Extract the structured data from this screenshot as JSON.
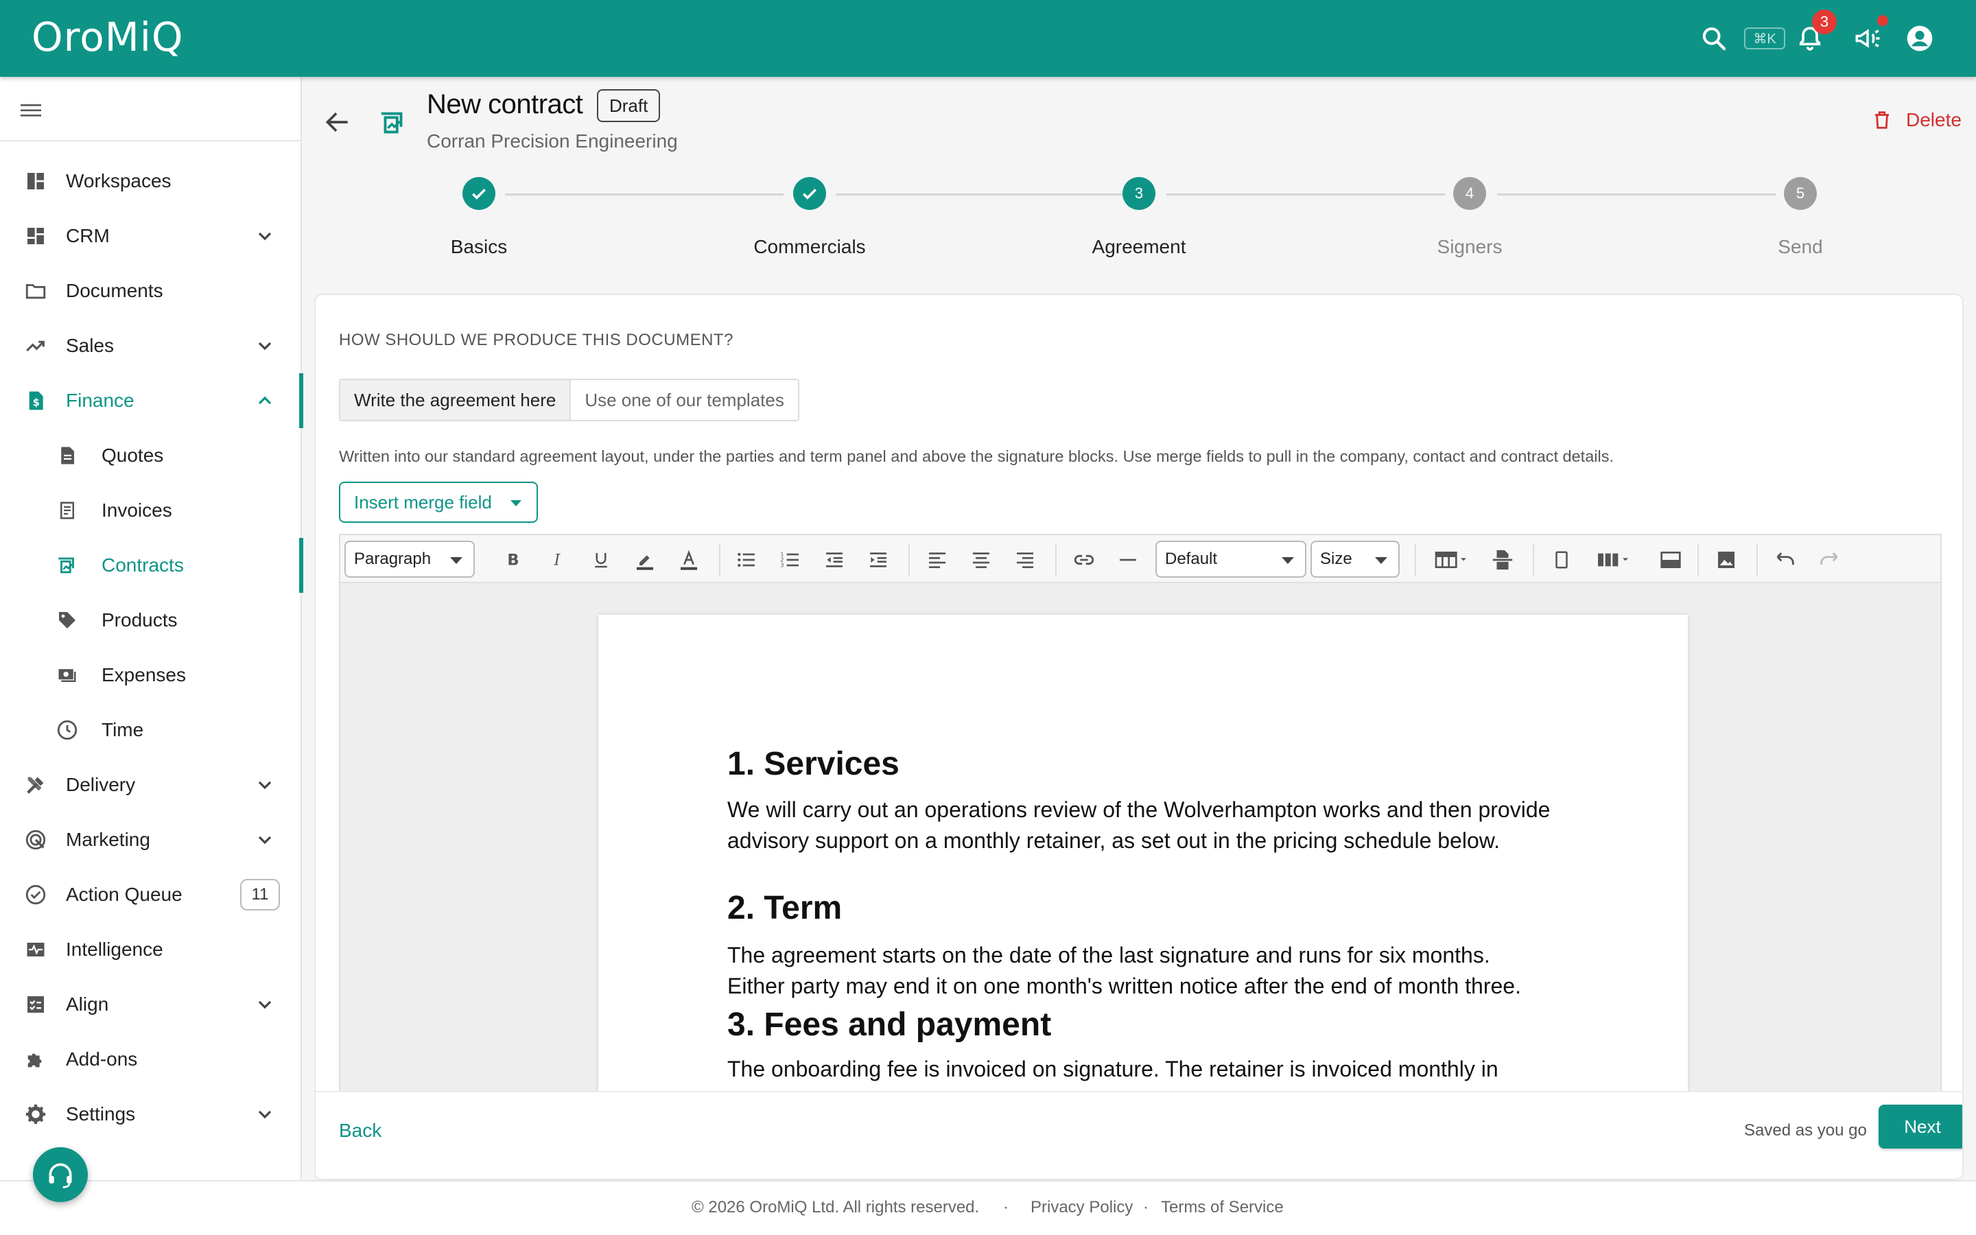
{
  "app": {
    "logo": "OroMiQ",
    "shortcut": "⌘K",
    "notification_count": "3"
  },
  "colors": {
    "accent": "#0e9486",
    "danger": "#d32f2f",
    "badge": "#e53935"
  },
  "sidebar": {
    "items": [
      {
        "label": "Workspaces",
        "icon": "dashboard-icon"
      },
      {
        "label": "CRM",
        "icon": "grid-icon"
      },
      {
        "label": "Documents",
        "icon": "folder-icon"
      },
      {
        "label": "Sales",
        "icon": "trending-up-icon"
      },
      {
        "label": "Finance",
        "icon": "finance-icon"
      },
      {
        "label": "Quotes",
        "icon": "document-icon"
      },
      {
        "label": "Invoices",
        "icon": "receipt-icon"
      },
      {
        "label": "Contracts",
        "icon": "contract-icon"
      },
      {
        "label": "Products",
        "icon": "tag-icon"
      },
      {
        "label": "Expenses",
        "icon": "money-icon"
      },
      {
        "label": "Time",
        "icon": "clock-icon"
      },
      {
        "label": "Delivery",
        "icon": "tools-icon"
      },
      {
        "label": "Marketing",
        "icon": "target-icon"
      },
      {
        "label": "Action Queue",
        "icon": "check-circle-icon",
        "count": "11"
      },
      {
        "label": "Intelligence",
        "icon": "pulse-icon"
      },
      {
        "label": "Align",
        "icon": "checklist-icon"
      },
      {
        "label": "Add-ons",
        "icon": "puzzle-icon"
      },
      {
        "label": "Settings",
        "icon": "gear-icon"
      }
    ]
  },
  "header": {
    "title": "New contract",
    "status": "Draft",
    "company": "Corran Precision Engineering",
    "delete_label": "Delete"
  },
  "stepper": {
    "steps": [
      {
        "number": "1",
        "label": "Basics",
        "state": "done"
      },
      {
        "number": "2",
        "label": "Commercials",
        "state": "done"
      },
      {
        "number": "3",
        "label": "Agreement",
        "state": "current"
      },
      {
        "number": "4",
        "label": "Signers",
        "state": "todo"
      },
      {
        "number": "5",
        "label": "Send",
        "state": "todo"
      }
    ]
  },
  "agreement": {
    "question": "HOW SHOULD WE PRODUCE THIS DOCUMENT?",
    "options": [
      "Write the agreement here",
      "Use one of our templates"
    ],
    "selected_option": "Write the agreement here",
    "help": "Written into our standard agreement layout, under the parties and term panel and above the signature blocks. Use merge fields to pull in the company, contact and contract details.",
    "merge_field_label": "Insert merge field"
  },
  "editor": {
    "block_format": "Paragraph",
    "font_family": "Default",
    "font_size": "Size",
    "sections": [
      {
        "heading": "1. Services",
        "body": "We will carry out an operations review of the Wolverhampton works and then provide advisory support on a monthly retainer, as set out in the pricing schedule below."
      },
      {
        "heading": "2. Term",
        "body": "The agreement starts on the date of the last signature and runs for six months. Either party may end it on one month's written notice after the end of month three."
      },
      {
        "heading": "3. Fees and payment",
        "body": "The onboarding fee is invoiced on signature. The retainer is invoiced monthly in"
      }
    ]
  },
  "footer_actions": {
    "back": "Back",
    "saved": "Saved as you go",
    "next": "Next"
  },
  "footer": {
    "copyright": "© 2026 OroMiQ Ltd. All rights reserved.",
    "separator": "·",
    "privacy": "Privacy Policy",
    "terms": "Terms of Service"
  }
}
